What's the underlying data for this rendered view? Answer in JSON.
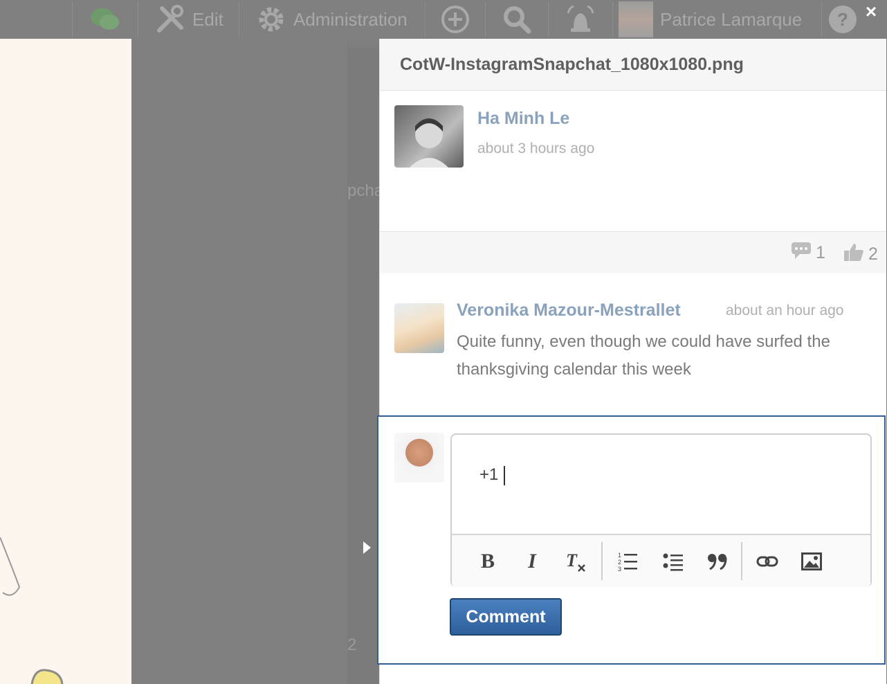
{
  "topbar": {
    "edit_label": "Edit",
    "admin_label": "Administration",
    "user_name": "Patrice Lamarque"
  },
  "background": {
    "partial_text": "pcha",
    "partial_count": "2"
  },
  "drawer": {
    "title": "CotW-InstagramSnapchat_1080x1080.png",
    "close_label": "×",
    "post": {
      "author": "Ha Minh Le",
      "time": "about 3 hours ago"
    },
    "stats": {
      "comments_count": "1",
      "likes_count": "2"
    },
    "comment": {
      "author": "Veronika Mazour-Mestrallet",
      "time": "about an hour ago",
      "text": "Quite funny, even though we could have surfed the thanksgiving calendar this week"
    },
    "compose": {
      "input_value": "+1",
      "submit_label": "Comment"
    }
  },
  "icons": {
    "chat": "chat-bubbles-icon",
    "edit": "wrench-icon",
    "admin": "gear-icon",
    "add": "plus-circle-icon",
    "search": "search-icon",
    "notifications": "alarm-bell-icon",
    "help": "help-icon"
  },
  "colors": {
    "link_blue": "#8aa2bd",
    "button_blue": "#2e5f9b",
    "compose_border": "#2f5f95",
    "left_panel": "#fdf6ee"
  }
}
